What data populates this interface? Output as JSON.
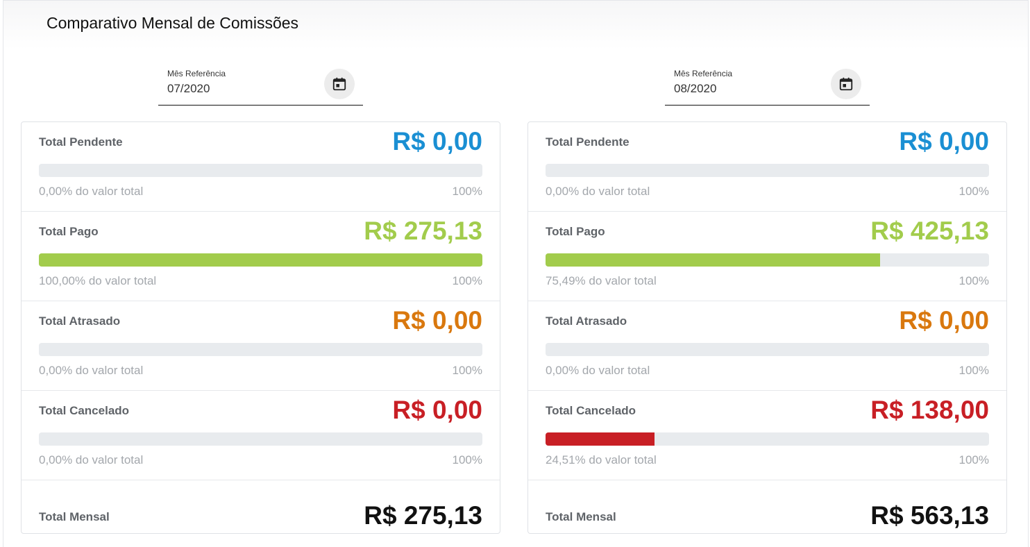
{
  "title": "Comparativo Mensal de Comissões",
  "cap_label": "100%",
  "colors": {
    "pendente": "#1a8fd3",
    "pago": "#a2cc4c",
    "atrasado": "#d9780e",
    "cancelado": "#c81f25"
  },
  "left": {
    "date_label": "Mês Referência",
    "date_value": "07/2020",
    "calendar_icon": "calendar-icon",
    "pendente": {
      "label": "Total Pendente",
      "amount": "R$ 0,00",
      "percent_text": "0,00% do valor total",
      "fraction": 0.0
    },
    "pago": {
      "label": "Total Pago",
      "amount": "R$ 275,13",
      "percent_text": "100,00% do valor total",
      "fraction": 1.0
    },
    "atrasado": {
      "label": "Total Atrasado",
      "amount": "R$ 0,00",
      "percent_text": "0,00% do valor total",
      "fraction": 0.0
    },
    "cancelado": {
      "label": "Total Cancelado",
      "amount": "R$ 0,00",
      "percent_text": "0,00% do valor total",
      "fraction": 0.0
    },
    "total": {
      "label": "Total Mensal",
      "amount": "R$ 275,13"
    }
  },
  "right": {
    "date_label": "Mês Referência",
    "date_value": "08/2020",
    "calendar_icon": "calendar-icon",
    "pendente": {
      "label": "Total Pendente",
      "amount": "R$ 0,00",
      "percent_text": "0,00% do valor total",
      "fraction": 0.0
    },
    "pago": {
      "label": "Total Pago",
      "amount": "R$ 425,13",
      "percent_text": "75,49% do valor total",
      "fraction": 0.7549
    },
    "atrasado": {
      "label": "Total Atrasado",
      "amount": "R$ 0,00",
      "percent_text": "0,00% do valor total",
      "fraction": 0.0
    },
    "cancelado": {
      "label": "Total Cancelado",
      "amount": "R$ 138,00",
      "percent_text": "24,51% do valor total",
      "fraction": 0.2451
    },
    "total": {
      "label": "Total Mensal",
      "amount": "R$ 563,13"
    }
  }
}
